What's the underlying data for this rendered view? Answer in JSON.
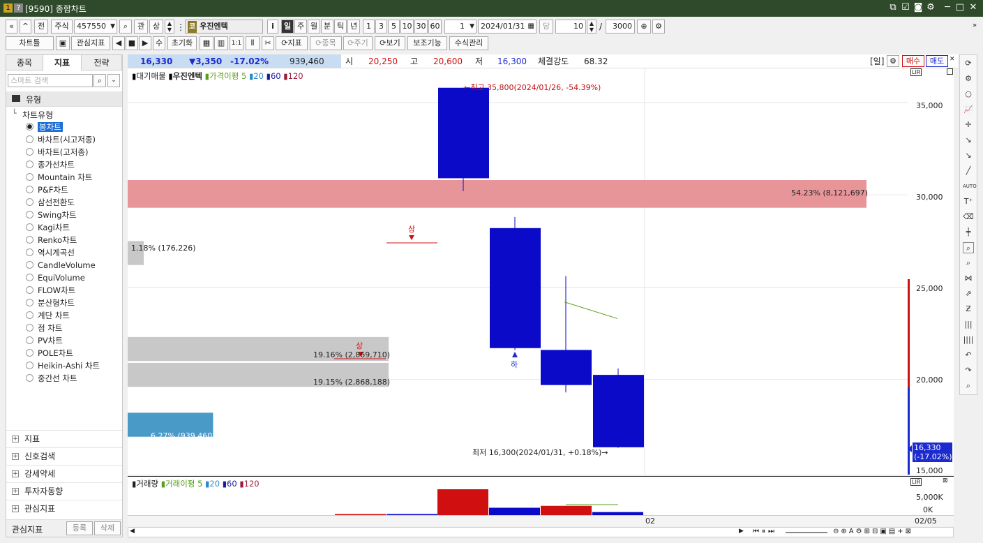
{
  "window": {
    "title": "[9590] 종합차트",
    "badge1": "1",
    "badge2": "?"
  },
  "toolbar1": {
    "market": "주식",
    "code": "457550",
    "btn_gwan": "관",
    "btn_sang": "상",
    "stock_name": "우진엔텍",
    "stock_badge": "코",
    "info_btn": "i",
    "periods": [
      "일",
      "주",
      "월",
      "분",
      "틱",
      "년"
    ],
    "selected_period": "일",
    "intervals": [
      "1",
      "3",
      "5",
      "10",
      "30",
      "60"
    ],
    "interval_value": "1",
    "date": "2024/01/31",
    "btn_dang": "당",
    "count": "10",
    "total": "3000",
    "slash": "/",
    "btn_jeon": "전"
  },
  "toolbar2": {
    "chart_tools": "차트틀",
    "interest_indicator": "관심지표",
    "su": "수",
    "init": "초기화",
    "indicator": "지표",
    "item": "종목",
    "period": "주기",
    "view": "보기",
    "aux": "보조기능",
    "formula": "수식관리",
    "one_to_one": "1:1"
  },
  "left_panel": {
    "tabs": [
      "종목",
      "지표",
      "전략"
    ],
    "active_tab": "지표",
    "search_placeholder": "스마트 검색",
    "group_header": "유형",
    "tree_root": "차트유형",
    "chart_types": [
      "봉차트",
      "바차트(시고저종)",
      "바차트(고저종)",
      "종가선차트",
      "Mountain 차트",
      "P&F차트",
      "삼선전환도",
      "Swing차트",
      "Kagi차트",
      "Renko차트",
      "역시계곡선",
      "CandleVolume",
      "EquiVolume",
      "FLOW차트",
      "분산형차트",
      "계단 차트",
      "점 차트",
      "PV차트",
      "POLE차트",
      "Heikin-Ashi 차트",
      "중간선 차트"
    ],
    "selected_chart_type": "봉차트",
    "accordion": [
      "지표",
      "신호검색",
      "강세약세",
      "투자자동향",
      "관심지표"
    ],
    "footer_label": "관심지표",
    "register_btn": "등록",
    "delete_btn": "삭제"
  },
  "infobar": {
    "price": "16,330",
    "change": "▼3,350",
    "change_pct": "-17.02%",
    "volume": "939,460",
    "open_label": "시",
    "open": "20,250",
    "high_label": "고",
    "high": "20,600",
    "low_label": "저",
    "low": "16,300",
    "strength_label": "체결강도",
    "strength": "68.32",
    "period_tag": "[일]",
    "buy": "매수",
    "sell": "매도"
  },
  "legend": {
    "items": [
      "대기매물",
      "우진엔텍",
      "가격이평 5",
      "20",
      "60",
      "120"
    ],
    "vol_items": [
      "거래량",
      "거래이평 5",
      "20",
      "60",
      "120"
    ]
  },
  "annotations": {
    "high": "←최고 35,800(2024/01/26, -54.39%)",
    "low": "최저 16,300(2024/01/31, +0.18%)→",
    "up1": "상",
    "up2": "상",
    "down": "하"
  },
  "volume_profile": [
    {
      "label": "54.23% (8,121,697)",
      "pct": 54.23
    },
    {
      "label": "1.18% (176,226)",
      "pct": 1.18
    },
    {
      "label": "19.16% (2,869,710)",
      "pct": 19.16
    },
    {
      "label": "19.15% (2,868,188)",
      "pct": 19.15
    },
    {
      "label": "6.27% (939,460)",
      "pct": 6.27
    }
  ],
  "y_axis": [
    "35,000",
    "30,000",
    "25,000",
    "20,000",
    "15,000"
  ],
  "vol_axis": [
    "5,000K",
    "0K"
  ],
  "current_price_tag": "16,330",
  "current_change_tag": "(-17.02%)",
  "x_axis": {
    "mid": "02",
    "right": "02/05"
  },
  "chart_data": {
    "type": "candlestick",
    "ylim": [
      15000,
      37000
    ],
    "candles": [
      {
        "o": 30900,
        "h": 35800,
        "l": 30200,
        "c": 35800,
        "up": false
      },
      {
        "o": 28200,
        "h": 28800,
        "l": 21600,
        "c": 21700,
        "up": false
      },
      {
        "o": 21600,
        "h": 25600,
        "l": 19300,
        "c": 19700,
        "up": false
      },
      {
        "o": 20250,
        "h": 20600,
        "l": 16300,
        "c": 16330,
        "up": false
      }
    ],
    "ma5": [
      {
        "i": 2,
        "v": 24200
      },
      {
        "i": 3,
        "v": 23300
      }
    ],
    "volume": [
      {
        "v": 200,
        "up": true
      },
      {
        "v": 60,
        "up": false
      },
      {
        "v": 8100,
        "up": true
      },
      {
        "v": 2300,
        "up": false
      },
      {
        "v": 2900,
        "up": true
      },
      {
        "v": 939,
        "up": false
      }
    ]
  }
}
